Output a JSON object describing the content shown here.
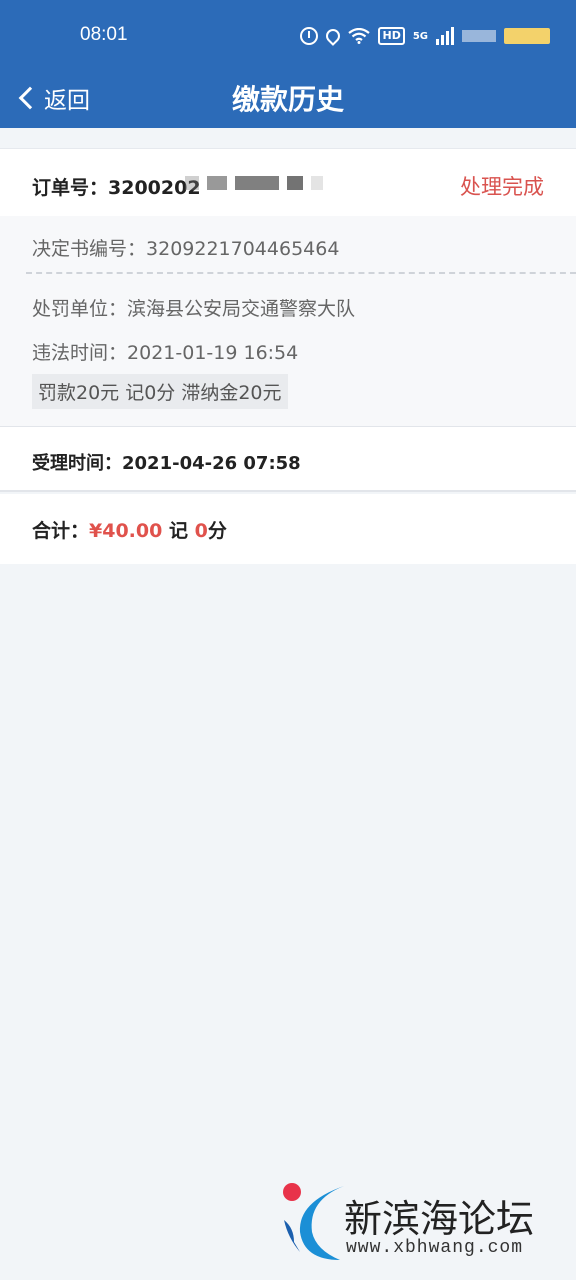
{
  "status_bar": {
    "time": "08:01",
    "network": "5G",
    "hd_badge": "HD"
  },
  "header": {
    "back_label": "返回",
    "title": "缴款历史"
  },
  "order": {
    "label": "订单号：",
    "number_visible": "3200202",
    "status": "处理完成"
  },
  "details": {
    "decision_label": "决定书编号：",
    "decision_number": "3209221704465464",
    "unit_label": "处罚单位：",
    "unit": "滨海县公安局交通警察大队",
    "time_label": "违法时间：",
    "time": "2021-01-19 16:54",
    "fee_tag": "罚款20元 记0分 滞纳金20元"
  },
  "accept": {
    "label": "受理时间：",
    "time": "2021-04-26 07:58"
  },
  "total": {
    "label": "合计：",
    "amount": "¥40.00",
    "points_prefix": "记",
    "points": "0",
    "points_suffix": "分"
  },
  "watermark": {
    "title": "新滨海论坛",
    "url": "www.xbhwang.com"
  },
  "colors": {
    "brand_blue": "#2c6bb8",
    "status_red": "#d9534f",
    "amount_red": "#e0524c"
  }
}
